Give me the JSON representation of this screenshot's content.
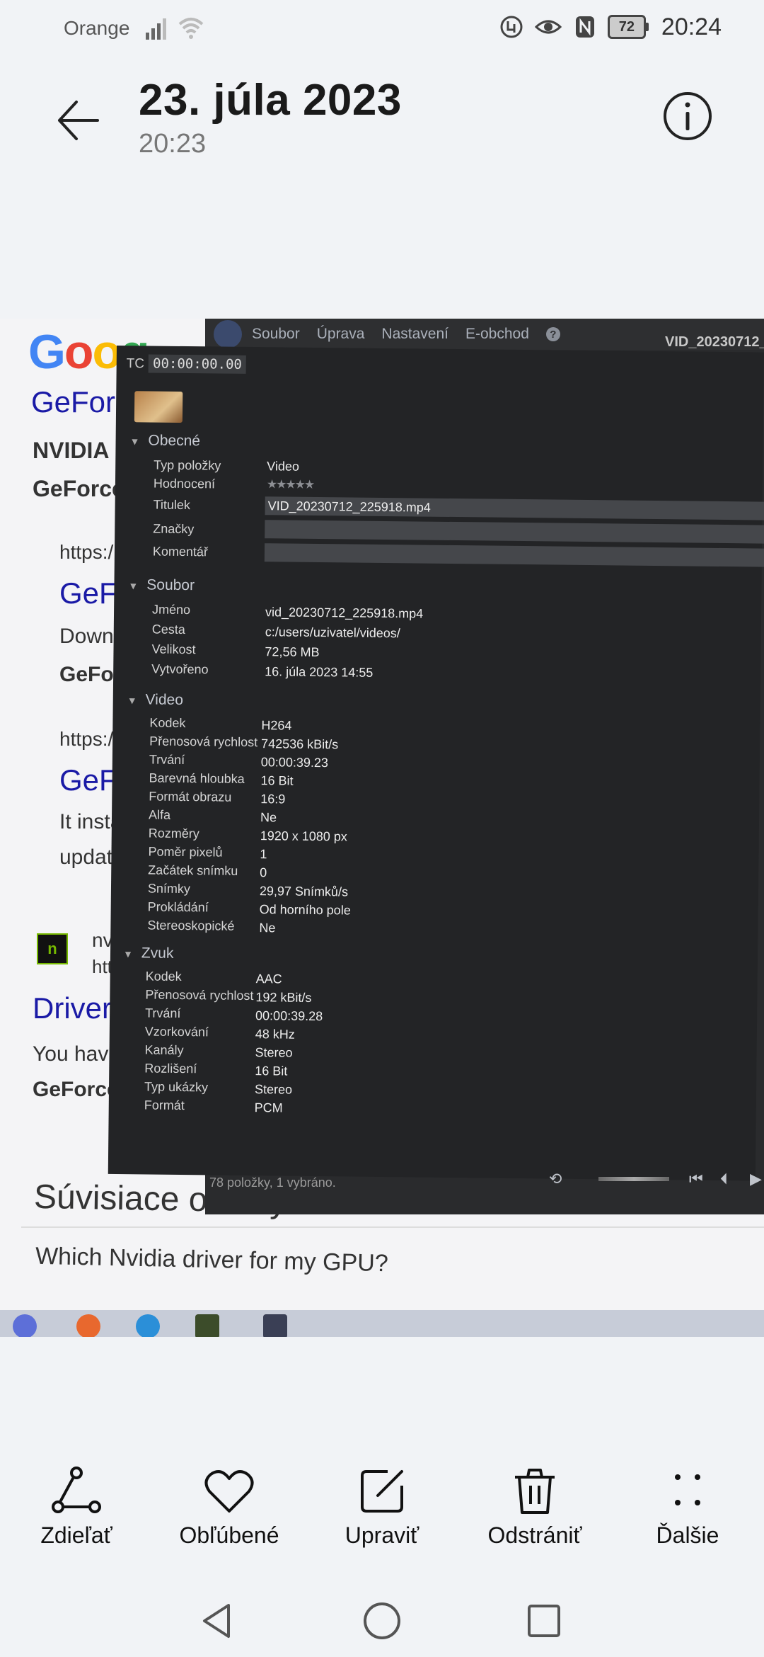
{
  "status_bar": {
    "carrier": "Orange",
    "battery": "72",
    "time": "20:24",
    "icons": [
      "signal-icon",
      "wifi-icon",
      "data-saver-icon",
      "eye-comfort-icon",
      "nfc-icon",
      "battery-icon"
    ]
  },
  "header": {
    "title": "23. júla 2023",
    "subtitle": "20:23"
  },
  "photo": {
    "browser": {
      "logo": [
        "G",
        "o",
        "o",
        "g"
      ],
      "lines": [
        {
          "text": "GeFor",
          "kind": "link"
        },
        {
          "text": "NVIDIA",
          "kind": "bold"
        },
        {
          "text": "GeForce",
          "kind": "bold"
        },
        {
          "text": "https:/",
          "kind": "text"
        },
        {
          "text": "GeF",
          "kind": "link"
        },
        {
          "text": "Down",
          "kind": "text"
        },
        {
          "text": "GeFo",
          "kind": "bold"
        },
        {
          "text": "https:/",
          "kind": "text"
        },
        {
          "text": "GeF",
          "kind": "link"
        },
        {
          "text": "It insta",
          "kind": "text"
        },
        {
          "text": "updat",
          "kind": "text"
        },
        {
          "text": "nv",
          "kind": "text"
        },
        {
          "text": "htt",
          "kind": "text"
        },
        {
          "text": "Driver",
          "kind": "link"
        },
        {
          "text": "You have",
          "kind": "text"
        },
        {
          "text": "GeForce",
          "kind": "bold"
        }
      ],
      "related_title": "Súvisiace otázky",
      "related_question": "Which Nvidia driver for my GPU?"
    },
    "app": {
      "menu": [
        "Soubor",
        "Úprava",
        "Nastavení",
        "E-obchod"
      ],
      "window_title": "VID_20230712_",
      "tc_label": "TC",
      "tc_value": "00:00:00.00",
      "status": "78 položky, 1 vybráno.",
      "sections": [
        {
          "title": "Obecné",
          "rows": [
            {
              "label": "Typ položky",
              "value": "Video"
            },
            {
              "label": "Hodnocení",
              "value": "★★★★★"
            },
            {
              "label": "Titulek",
              "value": "VID_20230712_225918.mp4"
            },
            {
              "label": "Značky",
              "value": ""
            },
            {
              "label": "Komentář",
              "value": ""
            }
          ]
        },
        {
          "title": "Soubor",
          "rows": [
            {
              "label": "Jméno",
              "value": "vid_20230712_225918.mp4"
            },
            {
              "label": "Cesta",
              "value": "c:/users/uzivatel/videos/"
            },
            {
              "label": "Velikost",
              "value": "72,56 MB"
            },
            {
              "label": "Vytvořeno",
              "value": "16. júla 2023 14:55"
            }
          ]
        },
        {
          "title": "Video",
          "rows": [
            {
              "label": "Kodek",
              "value": "H264"
            },
            {
              "label": "Přenosová rychlost",
              "value": "742536 kBit/s"
            },
            {
              "label": "Trvání",
              "value": "00:00:39.23"
            },
            {
              "label": "Barevná hloubka",
              "value": "16 Bit"
            },
            {
              "label": "Formát obrazu",
              "value": "16:9"
            },
            {
              "label": "Alfa",
              "value": "Ne"
            },
            {
              "label": "Rozměry",
              "value": "1920 x 1080 px"
            },
            {
              "label": "Poměr pixelů",
              "value": "1"
            },
            {
              "label": "Začátek snímku",
              "value": "0"
            },
            {
              "label": "Snímky",
              "value": "29,97 Snímků/s"
            },
            {
              "label": "Prokládání",
              "value": "Od horního pole"
            },
            {
              "label": "Stereoskopické",
              "value": "Ne"
            }
          ]
        },
        {
          "title": "Zvuk",
          "rows": [
            {
              "label": "Kodek",
              "value": "AAC"
            },
            {
              "label": "Přenosová rychlost",
              "value": "192 kBit/s"
            },
            {
              "label": "Trvání",
              "value": "00:00:39.28"
            },
            {
              "label": "Vzorkování",
              "value": "48 kHz"
            },
            {
              "label": "Kanály",
              "value": "Stereo"
            },
            {
              "label": "Rozlišení",
              "value": "16 Bit"
            },
            {
              "label": "Typ ukázky",
              "value": "Stereo"
            },
            {
              "label": "Formát",
              "value": "PCM"
            }
          ]
        }
      ]
    }
  },
  "toolbar": {
    "share": "Zdieľať",
    "favorite": "Obľúbené",
    "edit": "Upraviť",
    "delete": "Odstrániť",
    "more": "Ďalšie"
  },
  "navbar": {
    "icons": [
      "back-triangle-icon",
      "home-circle-icon",
      "recents-square-icon"
    ]
  }
}
